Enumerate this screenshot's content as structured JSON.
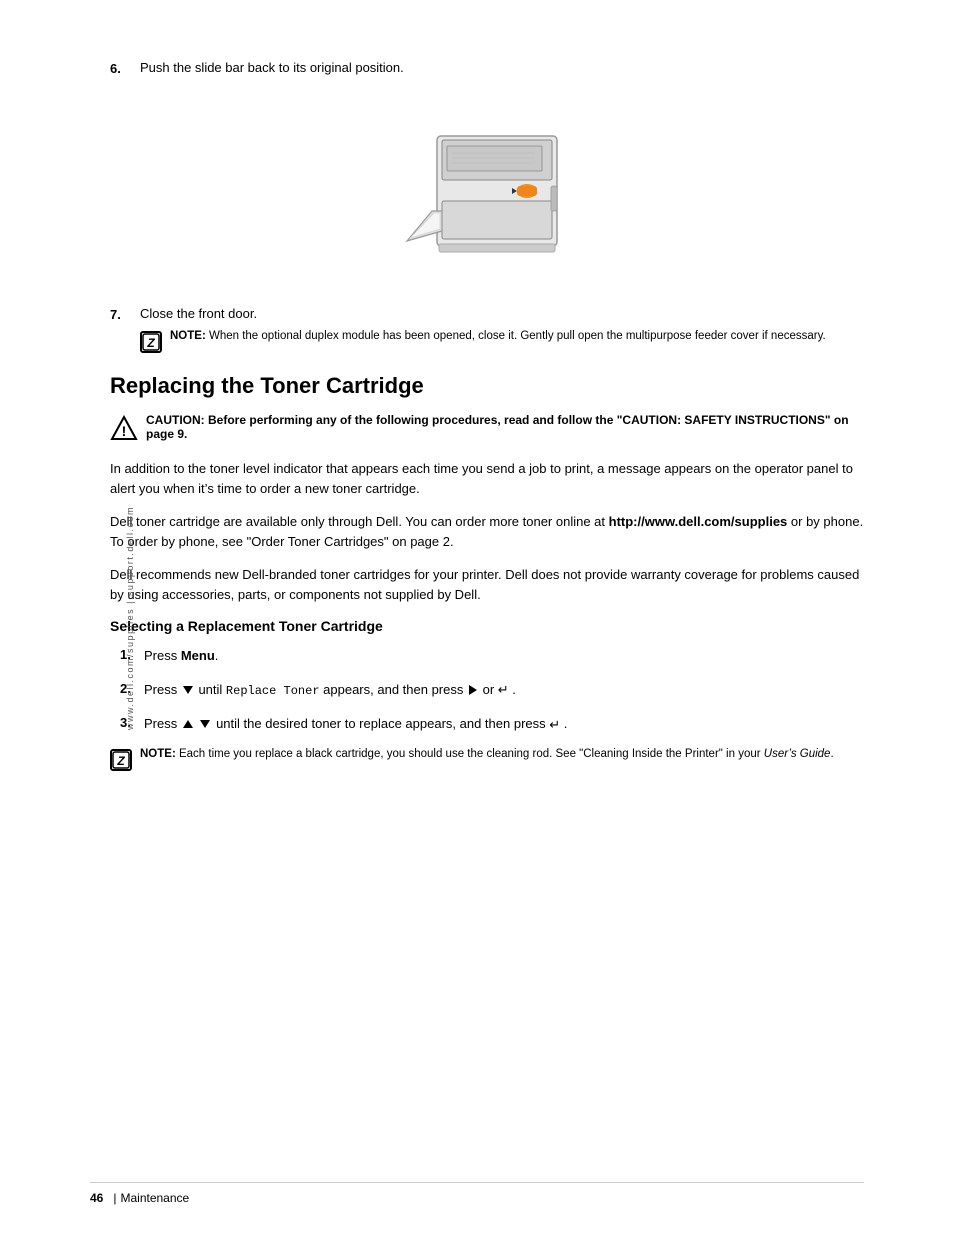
{
  "page": {
    "side_text": "www.dell.com/supplies | support.dell.com",
    "footer": {
      "page_number": "46",
      "separator": "|",
      "section": "Maintenance"
    }
  },
  "steps_top": {
    "step6": {
      "number": "6.",
      "text": "Push the slide bar back to its original position."
    },
    "step7": {
      "number": "7.",
      "text": "Close the front door."
    },
    "note1": {
      "icon_label": "Z",
      "label": "NOTE:",
      "text": "When the optional duplex module has been opened, close it. Gently pull open the multipurpose feeder cover if necessary."
    }
  },
  "section": {
    "heading": "Replacing the Toner Cartridge",
    "caution": {
      "label": "CAUTION:",
      "text": "Before performing any of the following procedures, read and follow the \"CAUTION: SAFETY INSTRUCTIONS\" on page 9."
    },
    "para1": "In addition to the toner level indicator that appears each time you send a job to print, a message appears on the operator panel to alert you when it’s time to order a new toner cartridge.",
    "para2_start": "Dell toner cartridge are available only through Dell. You can order more toner online at ",
    "para2_url": "http://www.dell.com/supplies",
    "para2_end": " or by phone. To order by phone, see \"Order Toner Cartridges\" on page 2.",
    "para3": "Dell recommends new Dell-branded toner cartridges for your printer. Dell does not provide warranty coverage for problems caused by using accessories, parts, or components not supplied by Dell.",
    "sub_heading": "Selecting a Replacement Toner Cartridge",
    "steps": [
      {
        "number": "1.",
        "text_before": "Press ",
        "bold": "Menu",
        "text_after": ".",
        "has_code": false,
        "has_enter": false,
        "has_arrows": false
      },
      {
        "number": "2.",
        "text_before": "Press ",
        "arrow_down": true,
        "text_mid": " until ",
        "code": "Replace Toner",
        "text_mid2": " appears, and then press ",
        "arrow_right": true,
        "text_or": " or ",
        "enter": true,
        "text_end": " ."
      },
      {
        "number": "3.",
        "text_before": "Press ",
        "arrow_up": true,
        "arrow_down2": true,
        "text_mid": " until the desired toner to replace appears, and then press ",
        "enter": true,
        "text_end": " ."
      }
    ],
    "note2": {
      "icon_label": "Z",
      "label": "NOTE:",
      "text": "Each time you replace a black cartridge, you should use the cleaning rod. See \"Cleaning Inside the Printer\" in your ",
      "italic": "User’s Guide",
      "text_end": "."
    }
  }
}
